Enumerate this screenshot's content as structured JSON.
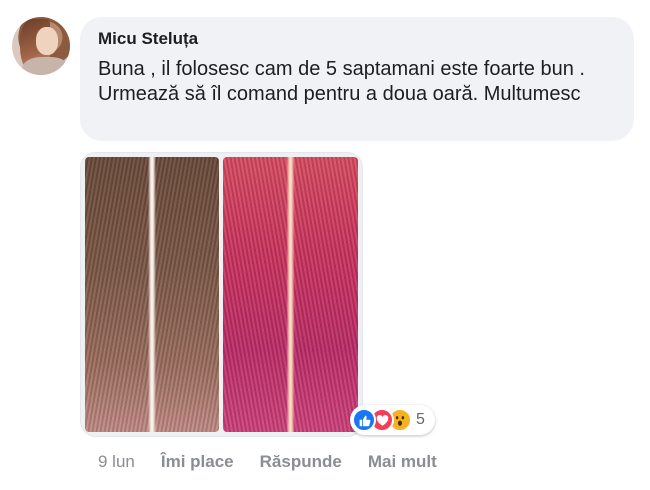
{
  "comment": {
    "author": "Micu Steluța",
    "text": "Buna , il folosesc cam de 5 saptamani este foarte bun . Urmează să îl comand pentru a doua oară. Multumesc"
  },
  "reactions": {
    "icons": [
      "like-icon",
      "love-icon",
      "wow-icon"
    ],
    "count": "5",
    "colors": {
      "like": "#1877f2",
      "love": "#f33e58",
      "wow": "#f7b125"
    }
  },
  "actions": {
    "time": "9 lun",
    "like_label": "Îmi place",
    "reply_label": "Răspunde",
    "more_label": "Mai mult"
  },
  "colors": {
    "bubble_bg": "#f0f2f5",
    "text": "#1c1e21",
    "muted": "#8a8d91"
  }
}
